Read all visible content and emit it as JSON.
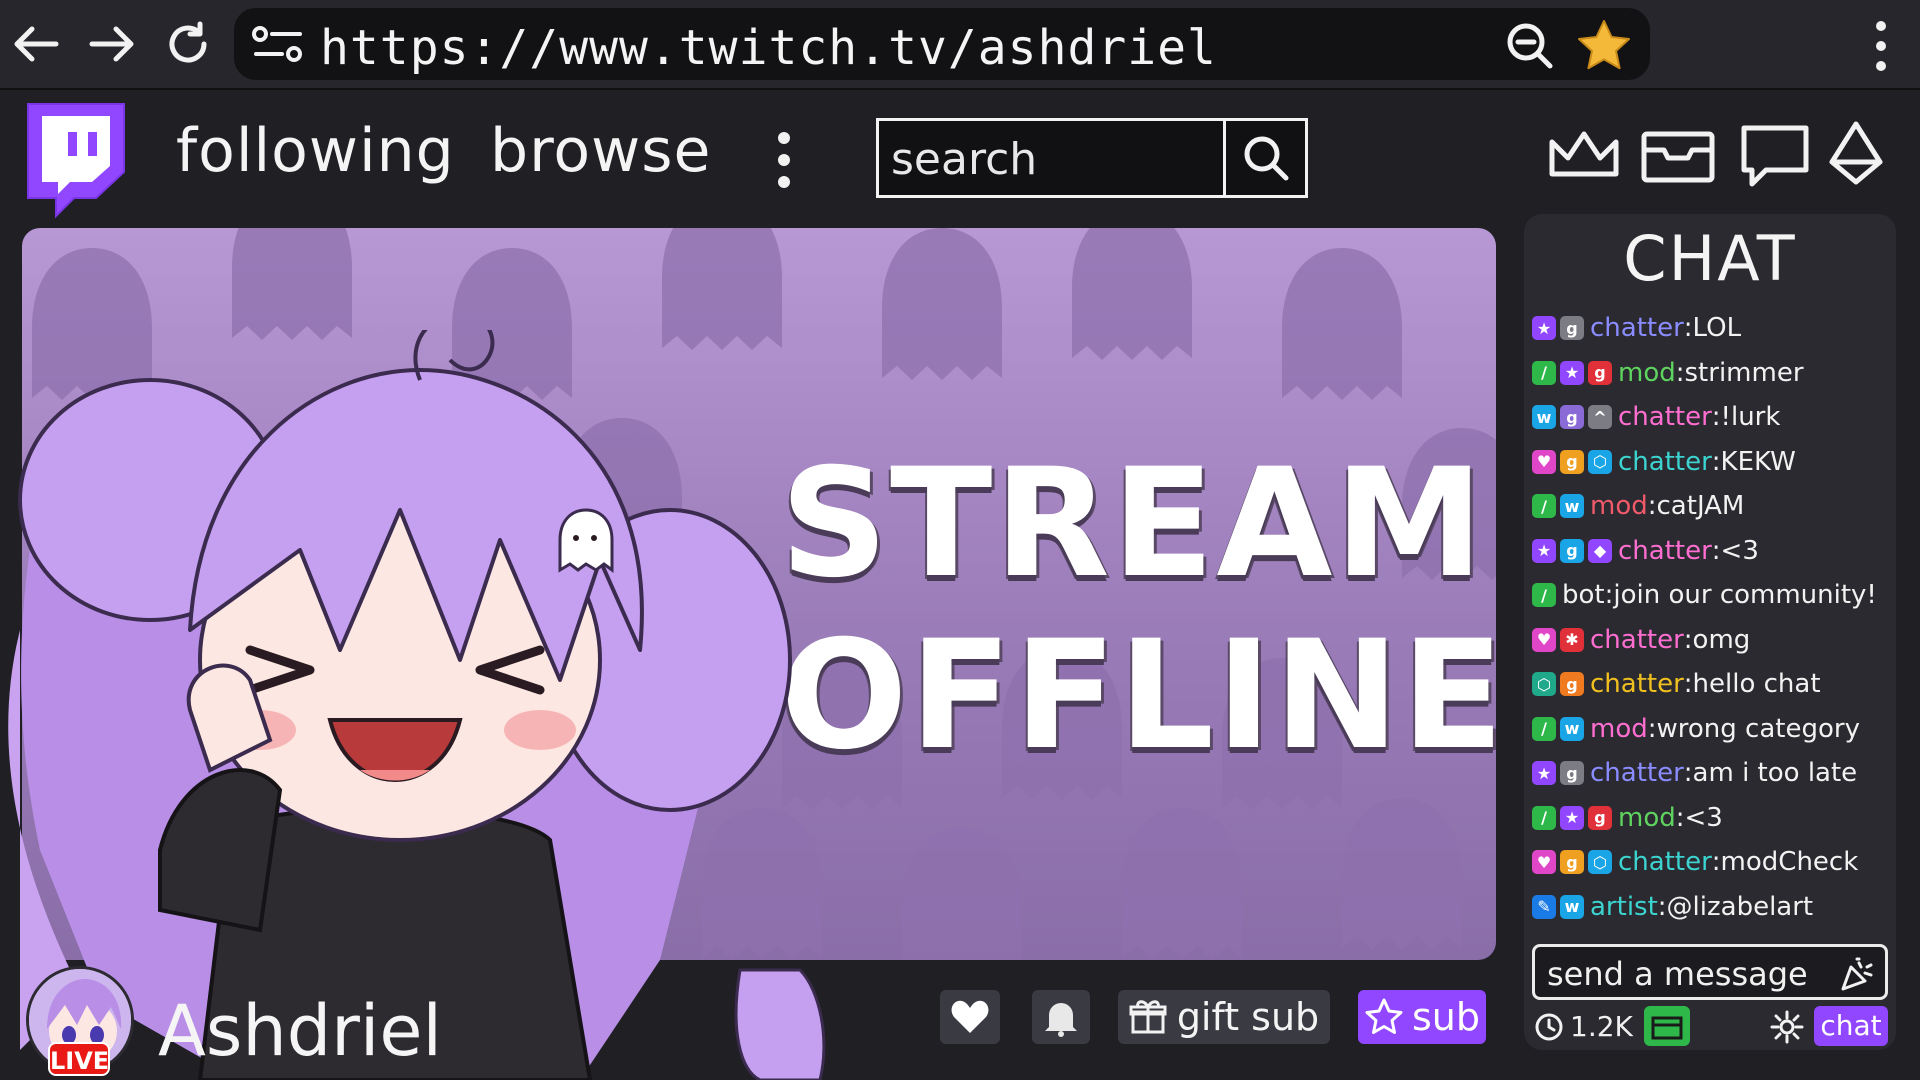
{
  "browser": {
    "url": "https://www.twitch.tv/ashdriel",
    "icons": [
      "back-arrow-icon",
      "forward-arrow-icon",
      "reload-icon",
      "site-settings-icon",
      "zoom-out-icon",
      "bookmark-star-icon",
      "browser-menu-icon"
    ],
    "star_color": "#f5b93a"
  },
  "header": {
    "logo": "twitch-logo",
    "nav": [
      "following",
      "browse"
    ],
    "search_placeholder": "search",
    "icons": [
      "crown-icon",
      "inbox-icon",
      "whispers-icon",
      "bits-gem-icon"
    ],
    "brand_color": "#9147ff"
  },
  "player": {
    "offline_line1": "STREAM",
    "offline_line2": "OFFLINE",
    "background_color": "#a688c4"
  },
  "channel": {
    "name": "Ashdriel",
    "live_badge": "LIVE",
    "gift_label": "gift sub",
    "sub_label": "sub"
  },
  "chat": {
    "title": "CHAT",
    "messages": [
      {
        "badges": [
          [
            "#9147ff",
            "★"
          ],
          [
            "#7c7c84",
            "g"
          ]
        ],
        "user": "chatter",
        "color": "#8a8cff",
        "text": "LOL"
      },
      {
        "badges": [
          [
            "#2fb84a",
            "/"
          ],
          [
            "#9147ff",
            "★"
          ],
          [
            "#e0303a",
            "g"
          ]
        ],
        "user": "mod",
        "color": "#5fd35f",
        "text": "strimmer"
      },
      {
        "badges": [
          [
            "#1aa6e6",
            "w"
          ],
          [
            "#8a6ad6",
            "g"
          ],
          [
            "#7c7c84",
            "^"
          ]
        ],
        "user": "chatter",
        "color": "#ff6ed0",
        "text": "!lurk"
      },
      {
        "badges": [
          [
            "#e046c8",
            "♥"
          ],
          [
            "#f0a020",
            "g"
          ],
          [
            "#1aa6e6",
            "⬡"
          ]
        ],
        "user": "chatter",
        "color": "#3cd4d0",
        "text": "KEKW"
      },
      {
        "badges": [
          [
            "#2fb84a",
            "/"
          ],
          [
            "#1aa6e6",
            "w"
          ]
        ],
        "user": "mod",
        "color": "#f05a6a",
        "text": "catJAM"
      },
      {
        "badges": [
          [
            "#9147ff",
            "★"
          ],
          [
            "#1aa6e6",
            "g"
          ],
          [
            "#9147ff",
            "◆"
          ]
        ],
        "user": "chatter",
        "color": "#ff6ed0",
        "text": "<3"
      },
      {
        "badges": [
          [
            "#2fb84a",
            "/"
          ]
        ],
        "user": "bot",
        "color": "#f2f2f2",
        "text": "join our community!"
      },
      {
        "badges": [
          [
            "#e046c8",
            "♥"
          ],
          [
            "#e0303a",
            "✱"
          ]
        ],
        "user": "chatter",
        "color": "#ff6ed0",
        "text": "omg"
      },
      {
        "badges": [
          [
            "#1fa88a",
            "⬡"
          ],
          [
            "#f07a20",
            "g"
          ]
        ],
        "user": "chatter",
        "color": "#f0c020",
        "text": "hello chat"
      },
      {
        "badges": [
          [
            "#2fb84a",
            "/"
          ],
          [
            "#1aa6e6",
            "w"
          ]
        ],
        "user": "mod",
        "color": "#ff6ed0",
        "text": "wrong category"
      },
      {
        "badges": [
          [
            "#9147ff",
            "★"
          ],
          [
            "#7c7c84",
            "g"
          ]
        ],
        "user": "chatter",
        "color": "#8a8cff",
        "text": "am i too late"
      },
      {
        "badges": [
          [
            "#2fb84a",
            "/"
          ],
          [
            "#9147ff",
            "★"
          ],
          [
            "#e0303a",
            "g"
          ]
        ],
        "user": "mod",
        "color": "#5fd35f",
        "text": "<3"
      },
      {
        "badges": [
          [
            "#e046c8",
            "♥"
          ],
          [
            "#f0a020",
            "g"
          ],
          [
            "#1aa6e6",
            "⬡"
          ]
        ],
        "user": "chatter",
        "color": "#3cd4d0",
        "text": "modCheck"
      },
      {
        "badges": [
          [
            "#1a7ae6",
            "✎"
          ],
          [
            "#1aa6e6",
            "w"
          ]
        ],
        "user": "artist",
        "color": "#3cd4d0",
        "text": "@lizabelart"
      }
    ],
    "input_placeholder": "send a message",
    "viewer_count": "1.2K",
    "send_label": "chat"
  }
}
